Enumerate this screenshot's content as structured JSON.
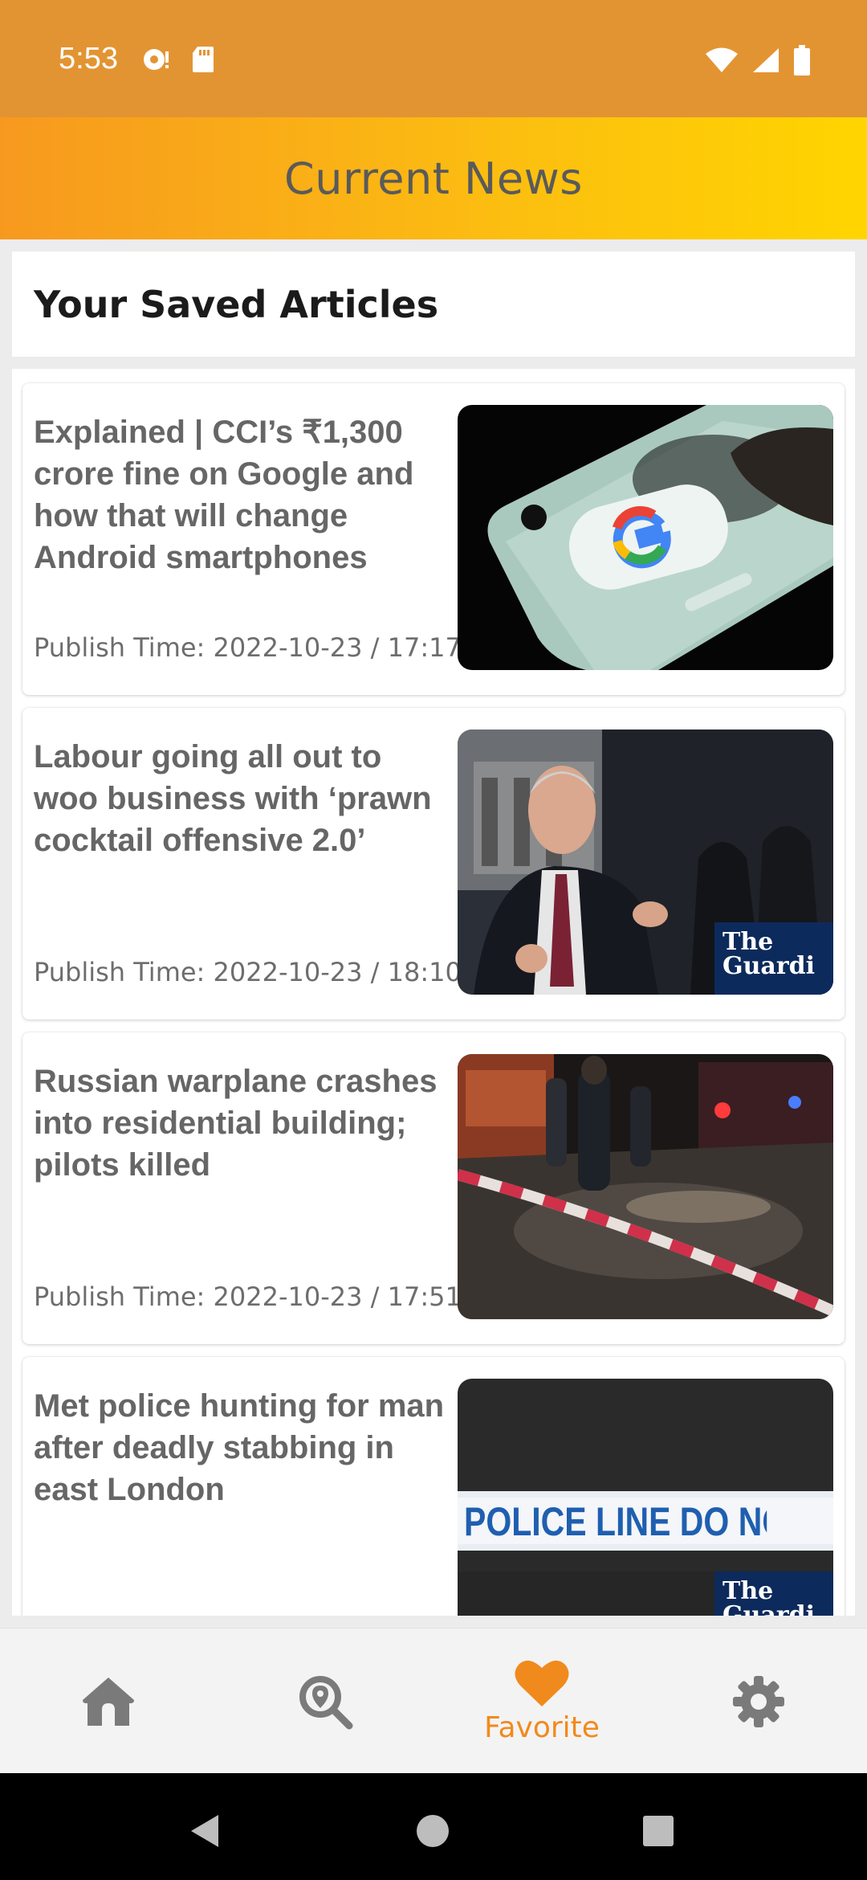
{
  "status_bar": {
    "time": "5:53"
  },
  "app_bar": {
    "title": "Current News"
  },
  "saved": {
    "title": "Your Saved Articles"
  },
  "articles": [
    {
      "title": "Explained | CCI’s ₹1,300 crore fine on Google and how that will change Android smartphones",
      "publish_time": "Publish Time: 2022-10-23 / 17:17",
      "image": "google-phone-image"
    },
    {
      "title": "Labour going all out to woo business with ‘prawn cocktail offensive 2.0’",
      "publish_time": "Publish Time: 2022-10-23 / 18:10",
      "image": "politician-image",
      "watermark": "The Guardian"
    },
    {
      "title": "Russian warplane crashes into residential building; pilots killed",
      "publish_time": "Publish Time: 2022-10-23 / 17:51",
      "image": "crash-scene-image"
    },
    {
      "title": "Met police hunting for man after deadly stabbing in east London",
      "publish_time": "",
      "image": "police-tape-image",
      "tape_text": "POLICE LINE DO NOT CROS",
      "watermark": "The Guardian"
    }
  ],
  "bottom_nav": {
    "items": [
      {
        "id": "home",
        "icon": "home-icon"
      },
      {
        "id": "explore",
        "icon": "search-location-icon"
      },
      {
        "id": "favorite",
        "icon": "heart-icon",
        "label": "Favorite",
        "active": true
      },
      {
        "id": "settings",
        "icon": "gear-icon"
      }
    ]
  },
  "colors": {
    "accent": "#f18a1c",
    "status_bar": "#e39432",
    "gradient_start": "#f7991f",
    "gradient_end": "#ffd500"
  }
}
